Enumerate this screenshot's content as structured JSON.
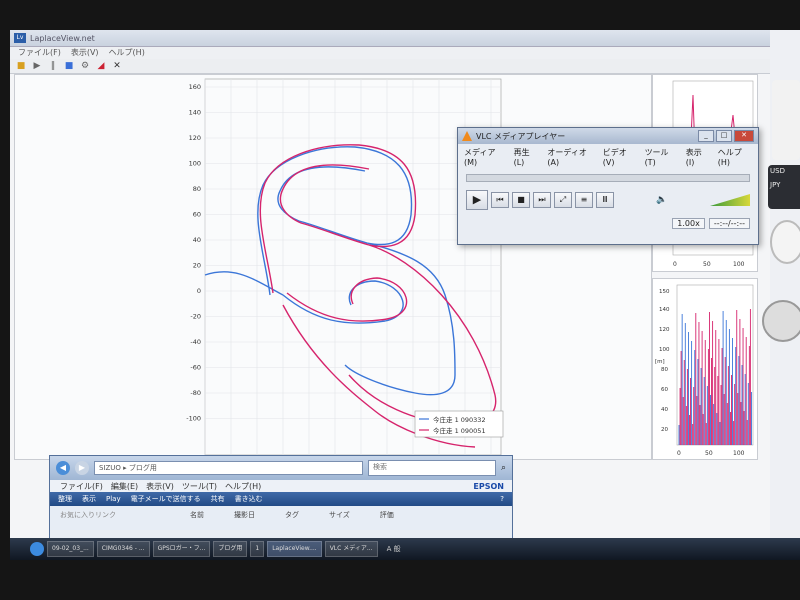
{
  "main_window": {
    "title": "LaplaceView.net",
    "menu": [
      "ファイル(F)",
      "表示(V)",
      "ヘルプ(H)"
    ]
  },
  "main_plot": {
    "y_ticks": [
      "160",
      "140",
      "120",
      "100",
      "80",
      "60",
      "40",
      "20",
      "0",
      "-20",
      "-40",
      "-60",
      "-80",
      "-100"
    ],
    "legend": [
      "今庄走 1 090332",
      "今庄走 1 090051"
    ]
  },
  "vlc": {
    "title": "VLC メディアプレイヤー",
    "menu": [
      "メディア (M)",
      "再生 (L)",
      "オーディオ (A)",
      "ビデオ (V)",
      "ツール (T)",
      "表示 (I)",
      "ヘルプ (H)"
    ],
    "speed": "1.00x",
    "time": "--:--/--:--"
  },
  "explorer": {
    "address": "SIZUO ▸ ブログ用",
    "search_placeholder": "検索",
    "menu": [
      "ファイル(F)",
      "編集(E)",
      "表示(V)",
      "ツール(T)",
      "ヘルプ(H)"
    ],
    "brand": "EPSON",
    "commands": [
      "整理",
      "表示",
      "Play",
      "電子メールで送信する",
      "共有",
      "書き込む"
    ],
    "columns": [
      "名前",
      "撮影日",
      "タグ",
      "サイズ",
      "評価"
    ],
    "favorites": "お気に入りリンク"
  },
  "taskbar": {
    "items": [
      "09-02_03_...",
      "CIMG0346 - ...",
      "GPSロガー・フ...",
      "ブログ用",
      "1",
      "LaplaceView....",
      "VLC メディア..."
    ],
    "tray_text": "A 般"
  },
  "side_plots": {
    "top_x_ticks": [
      "0",
      "50",
      "100"
    ],
    "bottom_x_ticks": [
      "0",
      "50",
      "100"
    ],
    "bottom_y_ticks": [
      "150",
      "140",
      "120",
      "100",
      "80",
      "60",
      "40",
      "20"
    ],
    "bottom_y_unit": "[m]"
  },
  "gadgets": {
    "currency": [
      "USD",
      "JPY"
    ]
  },
  "colors": {
    "track_red": "#d6246c",
    "track_blue": "#3b76d8",
    "accent": "#2b5ea8"
  }
}
